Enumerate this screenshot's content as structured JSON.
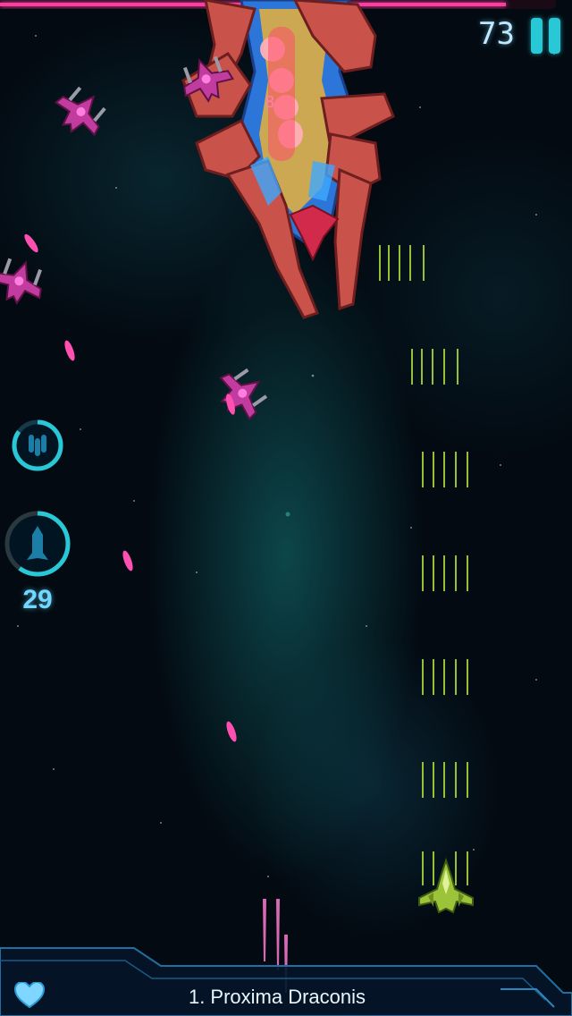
{
  "hud": {
    "score": "73",
    "boss_health": 0.91,
    "missile_count": "29",
    "level_name": "1. Proxima Draconis",
    "lives_icon": "heart-icon",
    "pause_icon": "pause-icon",
    "boss_weak_point_marker": "8"
  },
  "abilities": [
    {
      "name": "triple-shot-ability",
      "icon": "triple-bullet-icon",
      "cooldown_fraction": 0.85
    },
    {
      "name": "missile-ability",
      "icon": "missile-icon",
      "cooldown_fraction": 0.6
    }
  ],
  "colors": {
    "accent": "#29c8d6",
    "boss_bar": "#ff3aa0",
    "player_ship": "#9cc43a",
    "enemy": "#c23ca0",
    "enemy_bullet": "#ff4fb0",
    "player_bullet": "#a6d43a",
    "boss_hull": "#c9524a"
  }
}
